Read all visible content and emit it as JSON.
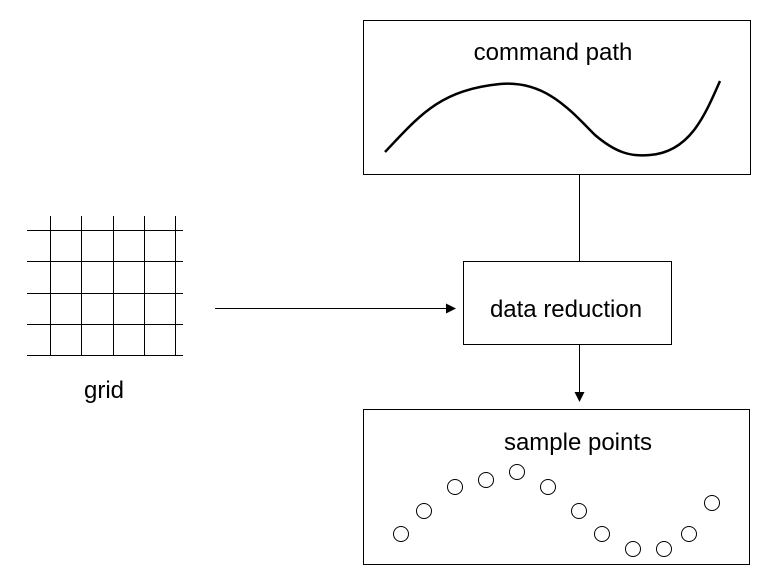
{
  "labels": {
    "command_path": "command path",
    "data_reduction": "data reduction",
    "sample_points": "sample points",
    "grid": "grid"
  },
  "colors": {
    "stroke": "#000000",
    "background": "#ffffff"
  },
  "grid": {
    "rows": 4,
    "columns": 5
  },
  "sample_points": {
    "count": 12
  },
  "edges": [
    {
      "from": "grid",
      "to": "data reduction",
      "arrow": true
    },
    {
      "from": "command path",
      "to": "data reduction",
      "arrow": false
    },
    {
      "from": "data reduction",
      "to": "sample points",
      "arrow": true
    }
  ]
}
